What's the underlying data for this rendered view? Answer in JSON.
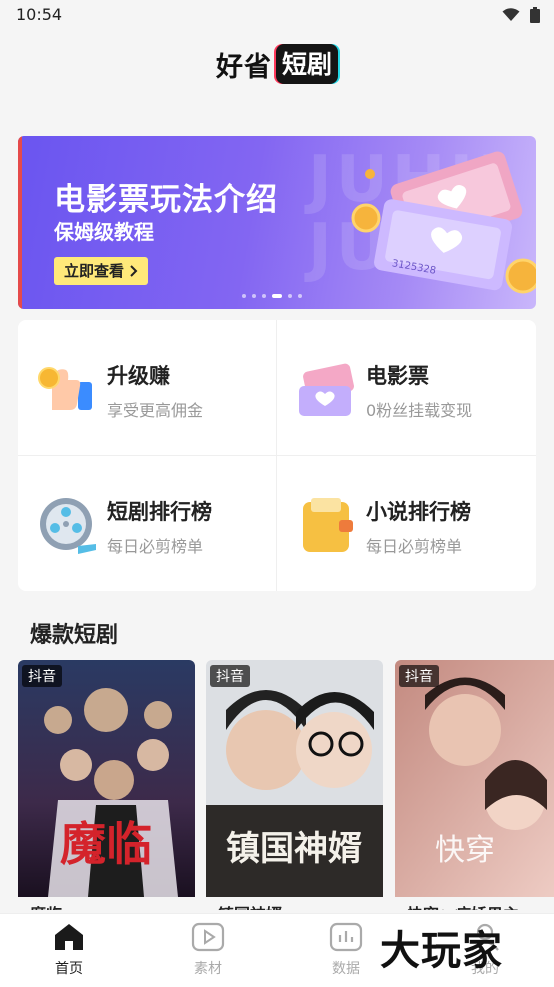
{
  "status_bar": {
    "time": "10:54"
  },
  "logo": {
    "part1": "好省",
    "part2": "短剧"
  },
  "banner": {
    "title": "电影票玩法介绍",
    "subtitle": "保姆级教程",
    "button": "立即查看",
    "watermark": "JUHU",
    "ticket_number": "3125328",
    "page_count": 6,
    "active_page": 4
  },
  "features": [
    {
      "title": "升级赚",
      "subtitle": "享受更高佣金",
      "icon": "thumbs-up-coin-icon"
    },
    {
      "title": "电影票",
      "subtitle": "0粉丝挂载变现",
      "icon": "movie-ticket-icon"
    },
    {
      "title": "短剧排行榜",
      "subtitle": "每日必剪榜单",
      "icon": "film-reel-icon"
    },
    {
      "title": "小说排行榜",
      "subtitle": "每日必剪榜单",
      "icon": "wallet-book-icon"
    }
  ],
  "section": {
    "title": "爆款短剧"
  },
  "dramas": [
    {
      "platform": "抖音",
      "name": "魔临",
      "poster_text": "魔临"
    },
    {
      "platform": "抖音",
      "name": "镇国神婿",
      "poster_text": "镇国神婿"
    },
    {
      "platform": "抖音",
      "name": "快穿：病娇男主",
      "poster_text": "快穿"
    }
  ],
  "nav": [
    {
      "label": "首页",
      "icon": "home-icon",
      "active": true
    },
    {
      "label": "素材",
      "icon": "play-icon",
      "active": false
    },
    {
      "label": "数据",
      "icon": "chart-icon",
      "active": false
    },
    {
      "label": "我的",
      "icon": "user-icon",
      "active": false
    }
  ],
  "watermark": {
    "text": "大玩家"
  },
  "colors": {
    "accent": "#7a62f2",
    "button": "#ffe97a",
    "text": "#222222",
    "subtext": "#999999"
  }
}
